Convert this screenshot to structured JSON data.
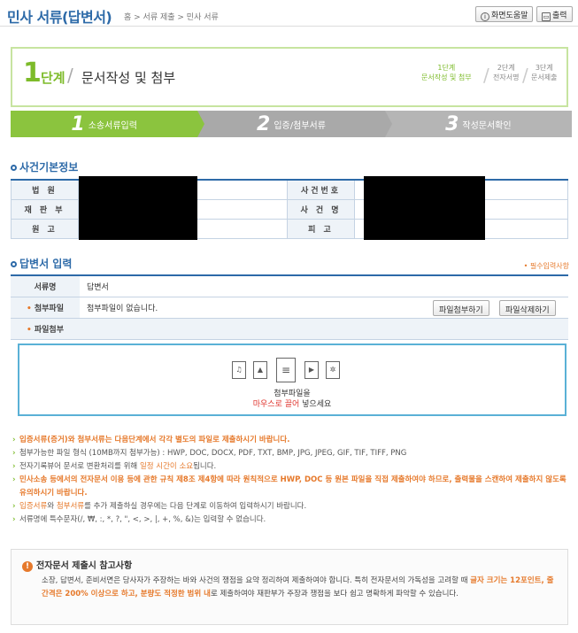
{
  "header": {
    "title": "민사 서류(답변서)",
    "breadcrumb": "홈 > 서류 제출 > 민사 서류",
    "help_label": "화면도움말",
    "print_label": "출력"
  },
  "stepbox": {
    "number": "1",
    "unit": "단계",
    "name": "문서작성 및 첨부",
    "mini": [
      {
        "line1": "1단계",
        "line2": "문서작성 및 첨부"
      },
      {
        "line1": "2단계",
        "line2": "전자서명"
      },
      {
        "line1": "3단계",
        "line2": "문서제출"
      }
    ]
  },
  "tabs": [
    {
      "num": "1",
      "label": "소송서류입력"
    },
    {
      "num": "2",
      "label": "입증/첨부서류"
    },
    {
      "num": "3",
      "label": "작성문서확인"
    }
  ],
  "case_info": {
    "title": "사건기본정보",
    "rows": [
      {
        "l1": "법 원",
        "v1": "",
        "l2": "사건번호",
        "v2": ""
      },
      {
        "l1": "재 판 부",
        "v1": "",
        "l2": "사 건 명",
        "v2": ""
      },
      {
        "l1": "원 고",
        "v1": "",
        "l2": "피 고",
        "v2": ""
      }
    ]
  },
  "answer": {
    "title": "답변서 입력",
    "required_note": "• 필수입력사항",
    "doc_name_label": "서류명",
    "doc_name_value": "답변서",
    "attach_label": "첨부파일",
    "attach_value": "첨부파일이 없습니다.",
    "attach_button": "파일첨부하기",
    "delete_button": "파일삭제하기",
    "attach_section_label": "파일첨부",
    "drop_line1": "첨부파일을",
    "drop_line2_a": "마우스로 끌어",
    "drop_line2_b": " 넣으세요"
  },
  "notes": [
    {
      "parts": [
        {
          "t": "입증서류(증거)와 첨부서류는 다음단계에서 각각 별도의 파일로 제출하시기 바랍니다.",
          "c": "ob"
        }
      ]
    },
    {
      "parts": [
        {
          "t": "첨부가능한 파일 형식 (10MB까지 첨부가능) : HWP, DOC, DOCX, PDF, TXT, BMP, JPG, JPEG, GIF, TIF, TIFF, PNG",
          "c": ""
        }
      ]
    },
    {
      "parts": [
        {
          "t": "전자기록뷰어 문서로 변환처리를 위해 ",
          "c": ""
        },
        {
          "t": "일정 시간이 소요",
          "c": "o"
        },
        {
          "t": "됩니다.",
          "c": ""
        }
      ]
    },
    {
      "parts": [
        {
          "t": "민사소송 등에서의 전자문서 이용 등에 관한 규칙 제8조 제4항에 따라 원칙적으로 HWP, DOC 등 원본 파일을 직접 제출하여야 하므로, 출력물을 스캔하여 제출하지 않도록 유의하시기 바랍니다.",
          "c": "ob"
        }
      ]
    },
    {
      "parts": [
        {
          "t": "입증서류",
          "c": "o"
        },
        {
          "t": "와 ",
          "c": ""
        },
        {
          "t": "첨부서류",
          "c": "o"
        },
        {
          "t": "를 추가 제출하실 경우에는 다음 단계로 이동하여 입력하시기 바랍니다.",
          "c": ""
        }
      ]
    },
    {
      "parts": [
        {
          "t": "서류명에 특수문자(/, ₩, :, *, ?, \", <, >, |, +, %, &)는 입력할 수 없습니다.",
          "c": ""
        }
      ]
    }
  ],
  "caution": {
    "title": "전자문서 제출시 참고사항",
    "body_a": "소장, 답변서, 준비서면은 당사자가 주장하는 바와 사건의 쟁점을 요약 정리하여 제출하여야 합니다. 특히 전자문서의 가독성을 고려할 때 ",
    "body_b": "글자 크기는 12포인트, 줄 간격은 200% 이상으로 하고, 분량도 적정한 범위 내",
    "body_c": "로 제출하여야 재판부가 주장과 쟁점을 보다 쉽고 명확하게 파악할 수 있습니다."
  },
  "colors": {
    "accent": "#2d6aa8",
    "green": "#8bc43e",
    "orange": "#e6792b",
    "drop_border": "#5ab1d6"
  }
}
